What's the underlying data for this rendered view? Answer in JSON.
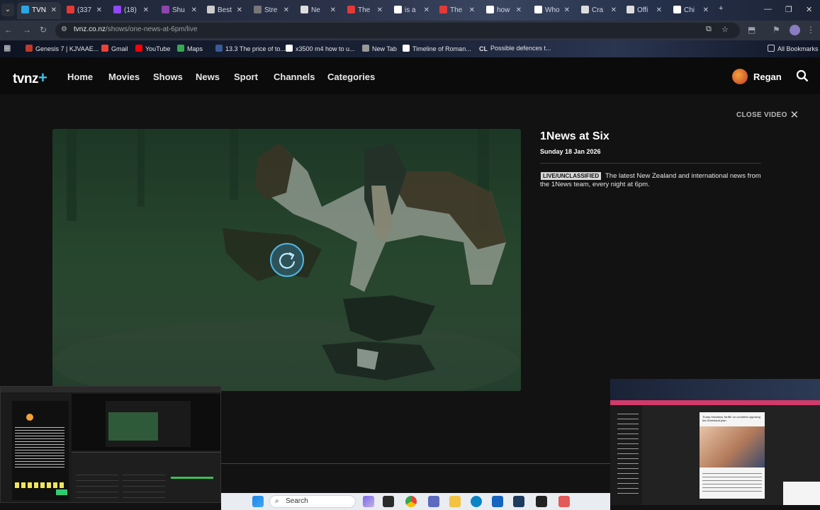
{
  "browser": {
    "tabs": [
      {
        "label": "TVN",
        "fav_color": "#2aa7e0",
        "active": true
      },
      {
        "label": "(337",
        "fav_color": "#e53935"
      },
      {
        "label": "(18)",
        "fav_color": "#9146ff"
      },
      {
        "label": "Shu",
        "fav_color": "#8e44ad"
      },
      {
        "label": "Best",
        "fav_color": "#cccccc"
      },
      {
        "label": "Stre",
        "fav_color": "#777777"
      },
      {
        "label": "Ne",
        "fav_color": "#dddddd"
      },
      {
        "label": "The",
        "fav_color": "#e53935"
      },
      {
        "label": "is a",
        "fav_color": "#ffffff"
      },
      {
        "label": "The",
        "fav_color": "#e53935"
      },
      {
        "label": "how",
        "fav_color": "#ffffff"
      },
      {
        "label": "Who",
        "fav_color": "#ffffff"
      },
      {
        "label": "Cra",
        "fav_color": "#dddddd"
      },
      {
        "label": "Offi",
        "fav_color": "#dddddd"
      },
      {
        "label": "Chi",
        "fav_color": "#ffffff"
      }
    ],
    "new_tab_symbol": "+",
    "url_host": "tvnz.co.nz",
    "url_path": "/shows/one-news-at-6pm/live",
    "bookmarks": [
      {
        "label": "Genesis 7 | KJVAAE...",
        "color": "#c0392b"
      },
      {
        "label": "Gmail",
        "color": "#ea4335"
      },
      {
        "label": "YouTube",
        "color": "#ff0000"
      },
      {
        "label": "Maps",
        "color": "#34a853"
      },
      {
        "label": "13.3 The price of to...",
        "color": "#3b5998"
      },
      {
        "label": "x3500 m4 how to u...",
        "color": "#ffffff"
      },
      {
        "label": "New Tab",
        "color": "#999999"
      },
      {
        "label": "Timeline of Roman...",
        "color": "#ffffff"
      },
      {
        "label": "Possible defences t...",
        "color": "#444444"
      }
    ],
    "bookmark_cl": "CL",
    "all_bookmarks": "All Bookmarks"
  },
  "site": {
    "logo_text": "tvnz",
    "logo_plus": "+",
    "nav": [
      "Home",
      "Movies",
      "Shows",
      "News",
      "Sport",
      "Channels",
      "Categories"
    ],
    "username": "Regan",
    "accent": "#3ec3e8"
  },
  "video": {
    "close_label": "CLOSE VIDEO",
    "close_symbol": "✕",
    "title": "1News at Six",
    "date": "Sunday 18 Jan 2026",
    "badge": "LIVE/UNCLASSIFIED",
    "description": "The latest New Zealand and international news from the 1News team, every night at 6pm."
  },
  "taskbar": {
    "search_placeholder": "Search"
  },
  "thumb_right": {
    "headline": "Trump threatens 'tariffs' on countries opposing his Greenland plan"
  }
}
